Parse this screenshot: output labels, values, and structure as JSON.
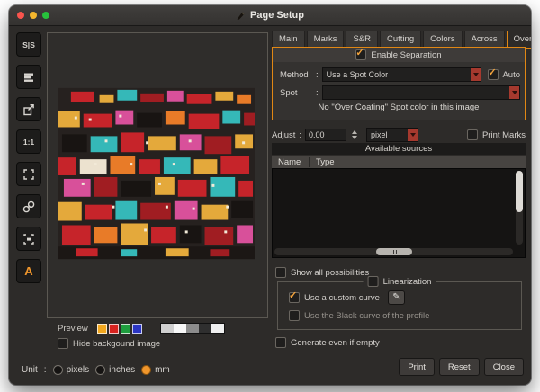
{
  "ui": {
    "colon": ":"
  },
  "window": {
    "title": "Page Setup"
  },
  "toolbar": {
    "split_label": "S|S",
    "ratio_label": "1:1",
    "text_label": "A"
  },
  "icons": {
    "edit_icon": "✎"
  },
  "preview": {
    "label": "Preview",
    "hide_background_label": "Hide backgound image",
    "swatches": [
      "background:#f2a71e",
      "background:#d8231f",
      "background:#1e9e3e",
      "background:#2b35c4"
    ],
    "grays": [
      "background:#cfcfcf",
      "background:#f7f7f7",
      "background:#8c8c8c",
      "background:#2f2f2f",
      "background:#efefef"
    ]
  },
  "unit": {
    "label": "Unit",
    "options": [
      {
        "label": "pixels",
        "selected": false
      },
      {
        "label": "inches",
        "selected": false
      },
      {
        "label": "mm",
        "selected": true
      }
    ]
  },
  "tabs": {
    "items": [
      "Main",
      "Marks",
      "S&R",
      "Cutting",
      "Colors",
      "Across",
      "Over Coating"
    ],
    "selected": "Over Coating"
  },
  "overcoating": {
    "enable_label": "Enable Separation",
    "enable_checked": true,
    "method_label": "Method",
    "method_value": "Use a Spot Color",
    "auto_label": "Auto",
    "auto_checked": true,
    "spot_label": "Spot",
    "spot_value": "",
    "empty_note": "No \"Over Coating\" Spot color in this image"
  },
  "adjust": {
    "label": "Adjust",
    "value": "0.00",
    "unit_value": "pixel",
    "print_marks_label": "Print Marks",
    "print_marks_checked": false
  },
  "sources": {
    "title": "Available sources",
    "columns": [
      "Name",
      "Type"
    ],
    "rows": [],
    "show_all_label": "Show all possibilities"
  },
  "linearization": {
    "title": "Linearization",
    "custom_curve_label": "Use a custom curve",
    "custom_curve_checked": true,
    "black_curve_label": "Use the Black curve of the profile",
    "black_curve_checked": false
  },
  "footer": {
    "generate_label": "Generate even if empty",
    "buttons": [
      "Print",
      "Reset",
      "Close"
    ]
  },
  "accent_color": "#e08714"
}
